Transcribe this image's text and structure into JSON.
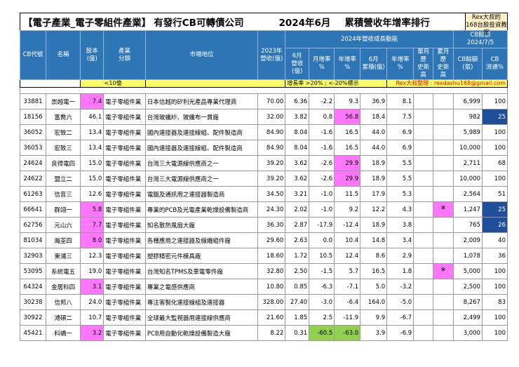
{
  "title": {
    "category": "【電子產業_電子零組件產業】",
    "subject": "有發行CB可轉債公司",
    "period": "2024年6月",
    "ranking": "累積營收年增率排行",
    "rex_line1": "Rex大叔的",
    "rex_line2": "168台股投資教室"
  },
  "headers": {
    "cb_code": "CB代號",
    "name": "名稱",
    "capital_l1": "股本",
    "capital_l2": "(億)",
    "industry_l1": "產業",
    "industry_l2": "分類",
    "market_pos": "市場地位",
    "rev2023_l1": "2023年",
    "rev2023_l2": "營收(億)",
    "growth_group": "2024年營收成長動能",
    "m6_rev_l1": "6月",
    "m6_rev_l2": "營收(億)",
    "mom_l1": "月增率",
    "mom_l2": "%",
    "yoy_l1": "年增率",
    "yoy_l2": "%",
    "m6_cum_l1": "6月",
    "m6_cum_l2": "累積(億)",
    "cum_yoy_l1": "年增率",
    "cum_yoy_l2": "%",
    "single_high_l1": "單月歷",
    "single_high_l2": "史新高",
    "cum_high_l1": "累月歷",
    "cum_high_l2": "史新高",
    "cb_group_l1": "CB餘額",
    "cb_group_l2": "2024/7/5",
    "cb_amt_l1": "CB餘額",
    "cb_amt_l2": "(張)",
    "cb_flow_l1": "CB",
    "cb_flow_l2": "流通%"
  },
  "legend": {
    "small_cap": "<10億",
    "growth_note": "增長率 >20% ; <-20%標示",
    "compiler": "Rex大叔整理 : rexdashu168@gmail.com"
  },
  "colors": {
    "header_bg": "#2e75b6",
    "pink": "#ff77ff",
    "green": "#92d050",
    "dark_blue": "#1f4e9a",
    "yellow": "#ffff66"
  },
  "rows": [
    {
      "code": "33881",
      "name": "崇越電一",
      "capital": "7.4",
      "industry": "電子零組件業",
      "market": "日本信越的矽利光產品專業代理商",
      "rev2023": "70.00",
      "m6": "6.36",
      "mom": "-2.2",
      "yoy": "9.3",
      "cum": "36.9",
      "cumyoy": "8.1",
      "shigh": "",
      "chigh": "",
      "cbamt": "6,999",
      "cbflow": "100",
      "hl": {
        "capital": "pink"
      }
    },
    {
      "code": "18156",
      "name": "富喬六",
      "capital": "46.1",
      "industry": "電子零組件業",
      "market": "台灣玻纖紗、玻纖布一貫廠",
      "rev2023": "32.00",
      "m6": "3.82",
      "mom": "0.8",
      "yoy": "56.8",
      "cum": "18.4",
      "cumyoy": "7.5",
      "shigh": "",
      "chigh": "",
      "cbamt": "982",
      "cbflow": "25",
      "hl": {
        "yoy": "pink",
        "cbflow": "blue"
      }
    },
    {
      "code": "36052",
      "name": "宏致二",
      "capital": "13.4",
      "industry": "電子零組件業",
      "market": "國內連接器及連接線組、配件製造商",
      "rev2023": "84.90",
      "m6": "8.04",
      "mom": "-1.6",
      "yoy": "16.5",
      "cum": "44.0",
      "cumyoy": "6.9",
      "shigh": "",
      "chigh": "",
      "cbamt": "5,989",
      "cbflow": "100",
      "hl": {}
    },
    {
      "code": "36053",
      "name": "宏致三",
      "capital": "13.4",
      "industry": "電子零組件業",
      "market": "國內連接器及連接線組、配件製造商",
      "rev2023": "84.90",
      "m6": "8.04",
      "mom": "-1.6",
      "yoy": "16.5",
      "cum": "44.0",
      "cumyoy": "6.9",
      "shigh": "",
      "chigh": "",
      "cbamt": "10,000",
      "cbflow": "100",
      "hl": {}
    },
    {
      "code": "24624",
      "name": "良得電四",
      "capital": "15.0",
      "industry": "電子零組件業",
      "market": "台灣三大電源線供應商之一",
      "rev2023": "39.20",
      "m6": "3.62",
      "mom": "-2.6",
      "yoy": "29.9",
      "cum": "18.9",
      "cumyoy": "5.5",
      "shigh": "",
      "chigh": "",
      "cbamt": "2,711",
      "cbflow": "68",
      "hl": {
        "yoy": "pink"
      }
    },
    {
      "code": "24622",
      "name": "盟立二",
      "capital": "15.0",
      "industry": "電子零組件業",
      "market": "台灣三大電源線供應商之一",
      "rev2023": "39.20",
      "m6": "3.62",
      "mom": "-2.6",
      "yoy": "29.9",
      "cum": "18.9",
      "cumyoy": "5.5",
      "shigh": "",
      "chigh": "",
      "cbamt": "10,000",
      "cbflow": "100",
      "hl": {
        "yoy": "pink"
      }
    },
    {
      "code": "61263",
      "name": "信音三",
      "capital": "12.6",
      "industry": "電子零組件業",
      "market": "電腦及通訊用之連接器製造商",
      "rev2023": "34.50",
      "m6": "3.21",
      "mom": "-1.0",
      "yoy": "11.5",
      "cum": "17.9",
      "cumyoy": "5.3",
      "shigh": "",
      "chigh": "",
      "cbamt": "2,564",
      "cbflow": "51",
      "hl": {}
    },
    {
      "code": "66641",
      "name": "群翊一",
      "capital": "5.8",
      "industry": "電子零組件業",
      "market": "專業的PCB及光電產業乾燥設備製造商",
      "rev2023": "24.30",
      "m6": "2.02",
      "mom": "-1.0",
      "yoy": "9.2",
      "cum": "12.2",
      "cumyoy": "4.3",
      "shigh": "",
      "chigh": "*",
      "cbamt": "1,247",
      "cbflow": "25",
      "hl": {
        "capital": "pink",
        "chigh": "pink",
        "cbflow": "blue"
      }
    },
    {
      "code": "62756",
      "name": "元山六",
      "capital": "7.7",
      "industry": "電子零組件業",
      "market": "知名散熱風扇大廠",
      "rev2023": "36.30",
      "m6": "2.87",
      "mom": "-17.9",
      "yoy": "-12.4",
      "cum": "18.9",
      "cumyoy": "3.8",
      "shigh": "",
      "chigh": "",
      "cbamt": "765",
      "cbflow": "26",
      "hl": {
        "capital": "pink",
        "cbflow": "blue"
      }
    },
    {
      "code": "81034",
      "name": "瀚荃四",
      "capital": "8.0",
      "industry": "電子零組件業",
      "market": "各種應用之連接器及線纜組件廠",
      "rev2023": "29.60",
      "m6": "2.63",
      "mom": "0.0",
      "yoy": "10.4",
      "cum": "14.8",
      "cumyoy": "3.4",
      "shigh": "",
      "chigh": "",
      "cbamt": "2,009",
      "cbflow": "40",
      "hl": {
        "capital": "pink"
      }
    },
    {
      "code": "32903",
      "name": "東浦三",
      "capital": "12.3",
      "industry": "電子零組件業",
      "market": "塑膠精密元件模具廠",
      "rev2023": "18.60",
      "m6": "1.72",
      "mom": "10.5",
      "yoy": "12.4",
      "cum": "8.6",
      "cumyoy": "2.9",
      "shigh": "",
      "chigh": "",
      "cbamt": "1,078",
      "cbflow": "36",
      "hl": {}
    },
    {
      "code": "53095",
      "name": "系統電五",
      "capital": "19.0",
      "industry": "電子零組件業",
      "market": "台灣知名TPMS及車電零件廠",
      "rev2023": "32.80",
      "m6": "2.50",
      "mom": "-1.5",
      "yoy": "5.7",
      "cum": "16.5",
      "cumyoy": "1.8",
      "shigh": "",
      "chigh": "*",
      "cbamt": "5,000",
      "cbflow": "100",
      "hl": {
        "chigh": "pink"
      }
    },
    {
      "code": "64324",
      "name": "金居科四",
      "capital": "3.1",
      "industry": "電子零組件業",
      "market": "專業之電感供應商",
      "rev2023": "10.80",
      "m6": "0.85",
      "mom": "-6.3",
      "yoy": "-7.1",
      "cum": "5.0",
      "cumyoy": "-3.2",
      "shigh": "",
      "chigh": "",
      "cbamt": "2,500",
      "cbflow": "100",
      "hl": {
        "capital": "pink"
      }
    },
    {
      "code": "30238",
      "name": "信邦八",
      "capital": "24.0",
      "industry": "電子零組件業",
      "market": "專注客製化連接線組及連接器",
      "rev2023": "328.00",
      "m6": "27.40",
      "mom": "-3.0",
      "yoy": "-6.4",
      "cum": "164.0",
      "cumyoy": "-5.0",
      "shigh": "",
      "chigh": "",
      "cbamt": "8,267",
      "cbflow": "83",
      "hl": {}
    },
    {
      "code": "30922",
      "name": "鴻碩二",
      "capital": "10.7",
      "industry": "電子零組件業",
      "market": "全球最大監視器用連接線供應商",
      "rev2023": "21.60",
      "m6": "1.85",
      "mom": "2.5",
      "yoy": "-11.9",
      "cum": "9.9",
      "cumyoy": "-6.7",
      "shigh": "",
      "chigh": "",
      "cbamt": "2,499",
      "cbflow": "100",
      "hl": {}
    },
    {
      "code": "45421",
      "name": "科嶠一",
      "capital": "3.2",
      "industry": "電子零組件業",
      "market": "PCB用自動化乾燥設備製造大廠",
      "rev2023": "8.22",
      "m6": "0.31",
      "mom": "-60.5",
      "yoy": "-63.0",
      "cum": "3.9",
      "cumyoy": "-6.9",
      "shigh": "",
      "chigh": "",
      "cbamt": "3,000",
      "cbflow": "100",
      "hl": {
        "capital": "pink",
        "mom": "green",
        "yoy": "green"
      }
    }
  ]
}
